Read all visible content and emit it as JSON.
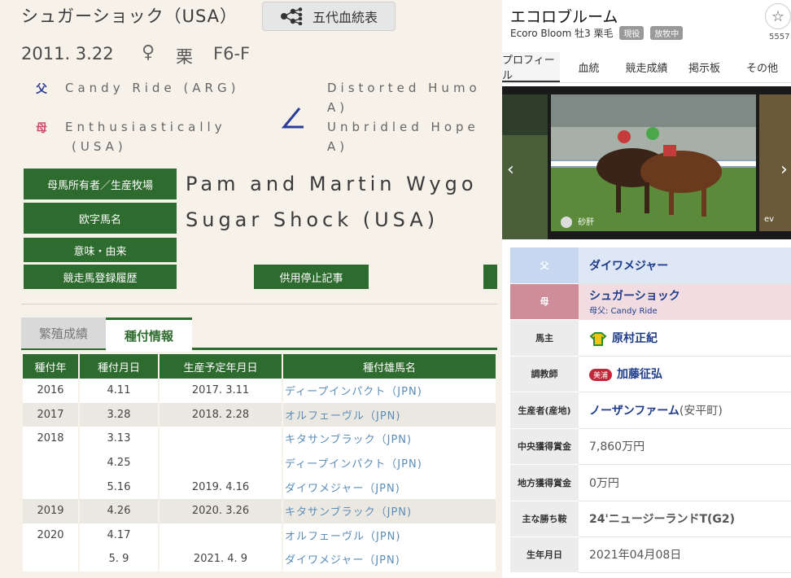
{
  "left": {
    "title": "シュガーショック（USA）",
    "pedigree_button": "五代血統表",
    "birth": "2011. 3.22",
    "sex_symbol": "♀",
    "coat": "栗",
    "grade": "F6-F",
    "sire_tag": "父",
    "sire": "Candy Ride (ARG)",
    "dam_tag": "母",
    "dam": "Enthusiastically",
    "dam2": "(USA)",
    "sire_sire_1": "Distorted Humo",
    "sire_sire_2": "A)",
    "dam_sire_1": "Unbridled Hope",
    "dam_sire_2": "A)",
    "rows": {
      "owner_label": "母馬所有者／生産牧場",
      "owner_value": "Pam and Martin Wygo",
      "latin_label": "欧字馬名",
      "latin_value": "Sugar Shock (USA)",
      "meaning_label": "意味・由来",
      "history_label": "競走馬登録履歴",
      "suspend_label": "供用停止記事"
    },
    "tabs": {
      "tab1": "繁殖成績",
      "tab2": "種付情報"
    },
    "table": {
      "headers": [
        "種付年",
        "種付月日",
        "生産予定年月日",
        "種付雄馬名"
      ],
      "rows": [
        {
          "y": "2016",
          "d": "4.11",
          "b": "2017. 3.11",
          "s": "ディープインパクト（JPN)"
        },
        {
          "y": "2017",
          "d": "3.28",
          "b": "2018. 2.28",
          "s": "オルフェーヴル（JPN)"
        },
        {
          "y": "2018",
          "d": "3.13",
          "b": "",
          "s": "キタサンブラック（JPN)"
        },
        {
          "y": "",
          "d": "4.25",
          "b": "",
          "s": "ディープインパクト（JPN)"
        },
        {
          "y": "",
          "d": "5.16",
          "b": "2019. 4.16",
          "s": "ダイワメジャー（JPN)"
        },
        {
          "y": "2019",
          "d": "4.26",
          "b": "2020. 3.26",
          "s": "キタサンブラック（JPN)"
        },
        {
          "y": "2020",
          "d": "4.17",
          "b": "",
          "s": "オルフェーヴル（JPN)"
        },
        {
          "y": "",
          "d": "5. 9",
          "b": "2021. 4. 9",
          "s": "ダイワメジャー（JPN)"
        }
      ]
    }
  },
  "right": {
    "name": "エコロブルーム",
    "sub": "Ecoro Bloom 牡3 栗毛",
    "badge1": "現役",
    "badge2": "放牧中",
    "fav_count": "5557",
    "tabs": [
      "プロフィール",
      "血統",
      "競走成績",
      "掲示板",
      "その他"
    ],
    "photo_credit_left": "砂肝",
    "photo_credit_right": "ev",
    "profile": {
      "sire_label": "父",
      "sire": "ダイワメジャー",
      "dam_label": "母",
      "dam": "シュガーショック",
      "dam_sire": "母父: Candy Ride",
      "owner_label": "馬主",
      "owner": "原村正紀",
      "trainer_label": "調教師",
      "trainer_badge": "美浦",
      "trainer": "加藤征弘",
      "breeder_label": "生産者(産地)",
      "breeder": "ノーザンファーム",
      "breeder_place": "(安平町)",
      "central_label": "中央獲得賞金",
      "central": "7,860万円",
      "local_label": "地方獲得賞金",
      "local": "0万円",
      "wins_label": "主な勝ち鞍",
      "wins": "24'ニュージーランドT(G2)",
      "dob_label": "生年月日",
      "dob": "2021年04月08日"
    }
  },
  "colors": {
    "green": "#2e6b2e",
    "sire_blue": "#c7d7ef",
    "dam_pink": "#cf8d9a",
    "link": "#1e3b8a"
  }
}
